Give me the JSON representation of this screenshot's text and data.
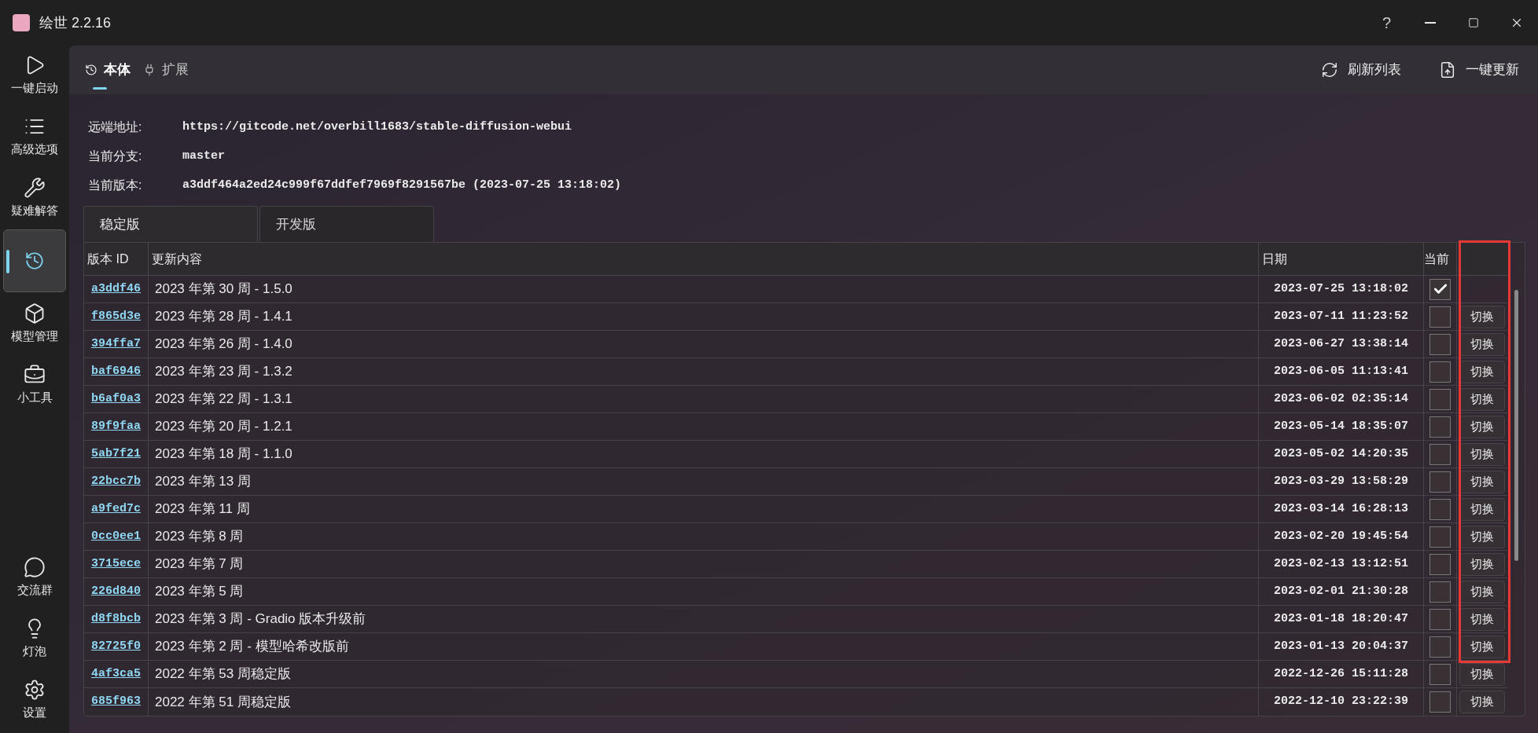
{
  "window": {
    "title": "绘世 2.2.16",
    "help": "?"
  },
  "sidebar": {
    "items": [
      {
        "label": "一键启动",
        "selected": false
      },
      {
        "label": "高级选项",
        "selected": false
      },
      {
        "label": "疑难解答",
        "selected": false
      },
      {
        "selected": true
      },
      {
        "label": "模型管理",
        "selected": false
      },
      {
        "label": "小工具",
        "selected": false
      }
    ],
    "bottom_items": [
      {
        "label": "交流群",
        "selected": false
      },
      {
        "label": "灯泡",
        "selected": false
      },
      {
        "label": "设置",
        "selected": false
      }
    ]
  },
  "header": {
    "tabs": [
      {
        "label": "本体",
        "selected": true
      },
      {
        "label": "扩展",
        "selected": false
      }
    ],
    "actions": [
      {
        "label": "刷新列表"
      },
      {
        "label": "一键更新"
      }
    ]
  },
  "info": [
    {
      "label": "远端地址:",
      "value": "https://gitcode.net/overbill1683/stable-diffusion-webui"
    },
    {
      "label": "当前分支:",
      "value": "master"
    },
    {
      "label": "当前版本:",
      "value": "a3ddf464a2ed24c999f67ddfef7969f8291567be (2023-07-25 13:18:02)"
    }
  ],
  "branch_tabs": [
    {
      "label": "稳定版",
      "selected": true
    },
    {
      "label": "开发版",
      "selected": false
    }
  ],
  "table": {
    "columns": [
      "版本 ID",
      "更新内容",
      "日期",
      "当前"
    ],
    "rows": [
      {
        "id": "a3ddf46",
        "content": "2023 年第 30 周 - 1.5.0",
        "date": "2023-07-25 13:18:02",
        "current": true
      },
      {
        "id": "f865d3e",
        "content": "2023 年第 28 周 - 1.4.1",
        "date": "2023-07-11 11:23:52",
        "current": false,
        "action": "切换"
      },
      {
        "id": "394ffa7",
        "content": "2023 年第 26 周 - 1.4.0",
        "date": "2023-06-27 13:38:14",
        "current": false,
        "action": "切换"
      },
      {
        "id": "baf6946",
        "content": "2023 年第 23 周 - 1.3.2",
        "date": "2023-06-05 11:13:41",
        "current": false,
        "action": "切换"
      },
      {
        "id": "b6af0a3",
        "content": "2023 年第 22 周 - 1.3.1",
        "date": "2023-06-02 02:35:14",
        "current": false,
        "action": "切换"
      },
      {
        "id": "89f9faa",
        "content": "2023 年第 20 周 - 1.2.1",
        "date": "2023-05-14 18:35:07",
        "current": false,
        "action": "切换"
      },
      {
        "id": "5ab7f21",
        "content": "2023 年第 18 周 - 1.1.0",
        "date": "2023-05-02 14:20:35",
        "current": false,
        "action": "切换"
      },
      {
        "id": "22bcc7b",
        "content": "2023 年第 13 周",
        "date": "2023-03-29 13:58:29",
        "current": false,
        "action": "切换"
      },
      {
        "id": "a9fed7c",
        "content": "2023 年第 11 周",
        "date": "2023-03-14 16:28:13",
        "current": false,
        "action": "切换"
      },
      {
        "id": "0cc0ee1",
        "content": "2023 年第 8 周",
        "date": "2023-02-20 19:45:54",
        "current": false,
        "action": "切换"
      },
      {
        "id": "3715ece",
        "content": "2023 年第 7 周",
        "date": "2023-02-13 13:12:51",
        "current": false,
        "action": "切换"
      },
      {
        "id": "226d840",
        "content": "2023 年第 5 周",
        "date": "2023-02-01 21:30:28",
        "current": false,
        "action": "切换"
      },
      {
        "id": "d8f8bcb",
        "content": "2023 年第 3 周 - Gradio 版本升级前",
        "date": "2023-01-18 18:20:47",
        "current": false,
        "action": "切换"
      },
      {
        "id": "82725f0",
        "content": "2023 年第 2 周 - 模型哈希改版前",
        "date": "2023-01-13 20:04:37",
        "current": false,
        "action": "切换"
      },
      {
        "id": "4af3ca5",
        "content": "2022 年第 53 周稳定版",
        "date": "2022-12-26 15:11:28",
        "current": false,
        "action": "切换"
      },
      {
        "id": "685f963",
        "content": "2022 年第 51 周稳定版",
        "date": "2022-12-10 23:22:39",
        "current": false,
        "action": "切换"
      }
    ]
  }
}
